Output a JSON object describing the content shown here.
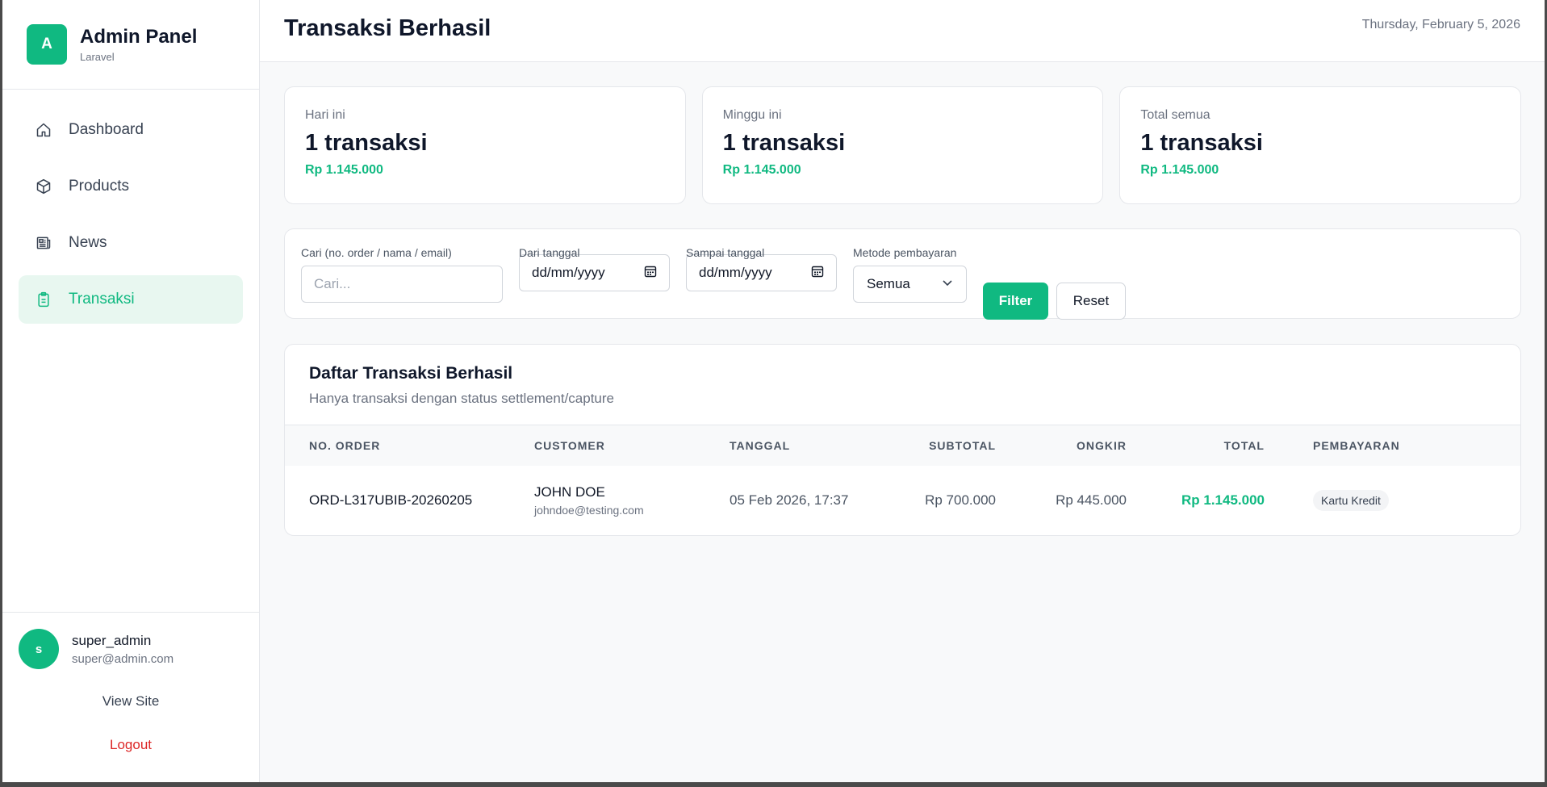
{
  "brand": {
    "initial": "A",
    "title": "Admin Panel",
    "subtitle": "Laravel"
  },
  "nav": [
    {
      "label": "Dashboard",
      "icon": "home-icon"
    },
    {
      "label": "Products",
      "icon": "box-icon"
    },
    {
      "label": "News",
      "icon": "newspaper-icon"
    },
    {
      "label": "Transaksi",
      "icon": "clipboard-icon",
      "active": true
    }
  ],
  "user": {
    "initial": "s",
    "name": "super_admin",
    "email": "super@admin.com"
  },
  "footer": {
    "view_site": "View Site",
    "logout": "Logout"
  },
  "header": {
    "title": "Transaksi Berhasil",
    "date": "Thursday, February 5, 2026"
  },
  "stats": [
    {
      "label": "Hari ini",
      "value": "1 transaksi",
      "amount": "Rp 1.145.000"
    },
    {
      "label": "Minggu ini",
      "value": "1 transaksi",
      "amount": "Rp 1.145.000"
    },
    {
      "label": "Total semua",
      "value": "1 transaksi",
      "amount": "Rp 1.145.000"
    }
  ],
  "filters": {
    "search_label": "Cari (no. order / nama / email)",
    "search_placeholder": "Cari...",
    "from_label": "Dari tanggal",
    "from_value": "dd/mm/yyyy",
    "to_label": "Sampai tanggal",
    "to_value": "dd/mm/yyyy",
    "method_label": "Metode pembayaran",
    "method_value": "Semua",
    "filter_button": "Filter",
    "reset_button": "Reset"
  },
  "table": {
    "title": "Daftar Transaksi Berhasil",
    "subtitle": "Hanya transaksi dengan status settlement/capture",
    "columns": [
      "NO. ORDER",
      "CUSTOMER",
      "TANGGAL",
      "SUBTOTAL",
      "ONGKIR",
      "TOTAL",
      "PEMBAYARAN"
    ],
    "rows": [
      {
        "order": "ORD-L317UBIB-20260205",
        "customer_name": "JOHN DOE",
        "customer_email": "johndoe@testing.com",
        "date": "05 Feb 2026, 17:37",
        "subtotal": "Rp 700.000",
        "shipping": "Rp 445.000",
        "total": "Rp 1.145.000",
        "payment": "Kartu Kredit"
      }
    ]
  },
  "colors": {
    "accent": "#10b981",
    "danger": "#dc2626",
    "active_bg": "#e8f7f0"
  }
}
